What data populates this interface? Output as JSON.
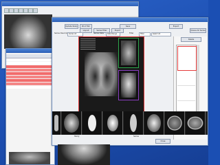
{
  "back_window": {
    "tool_icons": [
      "arrow-icon",
      "zoom-icon",
      "pan-icon",
      "contrast-icon",
      "rotate-icon",
      "flip-icon",
      "grid-icon"
    ]
  },
  "list_window": {
    "highlight_color": "#f26b6b"
  },
  "main_window": {
    "toolbar": {
      "row1_buttons": [
        "Update Study",
        "Print Film",
        "Save",
        "Export"
      ],
      "row2_buttons": [
        "Layout",
        "Series Filter",
        "Export",
        "Queue All Series"
      ],
      "filter_labels": [
        "Series Description",
        "Series Date",
        "Filter"
      ],
      "filter_values": [
        "Series All",
        "Date Range",
        "Filter",
        "Select All"
      ]
    },
    "viewer_frame_color": "#e43a3a",
    "secondary_frame_color": "#2ea84d",
    "tertiary_frame_color": "#8b3fc4",
    "right_panel": {
      "button": "Delete",
      "accent": "#e43a3a"
    },
    "bottom": {
      "labels": [
        "Study",
        "Series"
      ],
      "close_button": "Close"
    }
  },
  "thumbnails": [
    {
      "icon": "xray-spine-icon"
    },
    {
      "icon": "xray-chest-icon"
    },
    {
      "icon": "xray-head-icon"
    },
    {
      "icon": "xray-hand-icon"
    },
    {
      "icon": "xray-pelvis-icon"
    },
    {
      "icon": "xray-knee-icon"
    },
    {
      "icon": "ct-brain-icon"
    },
    {
      "icon": "ct-abdomen-icon"
    }
  ]
}
